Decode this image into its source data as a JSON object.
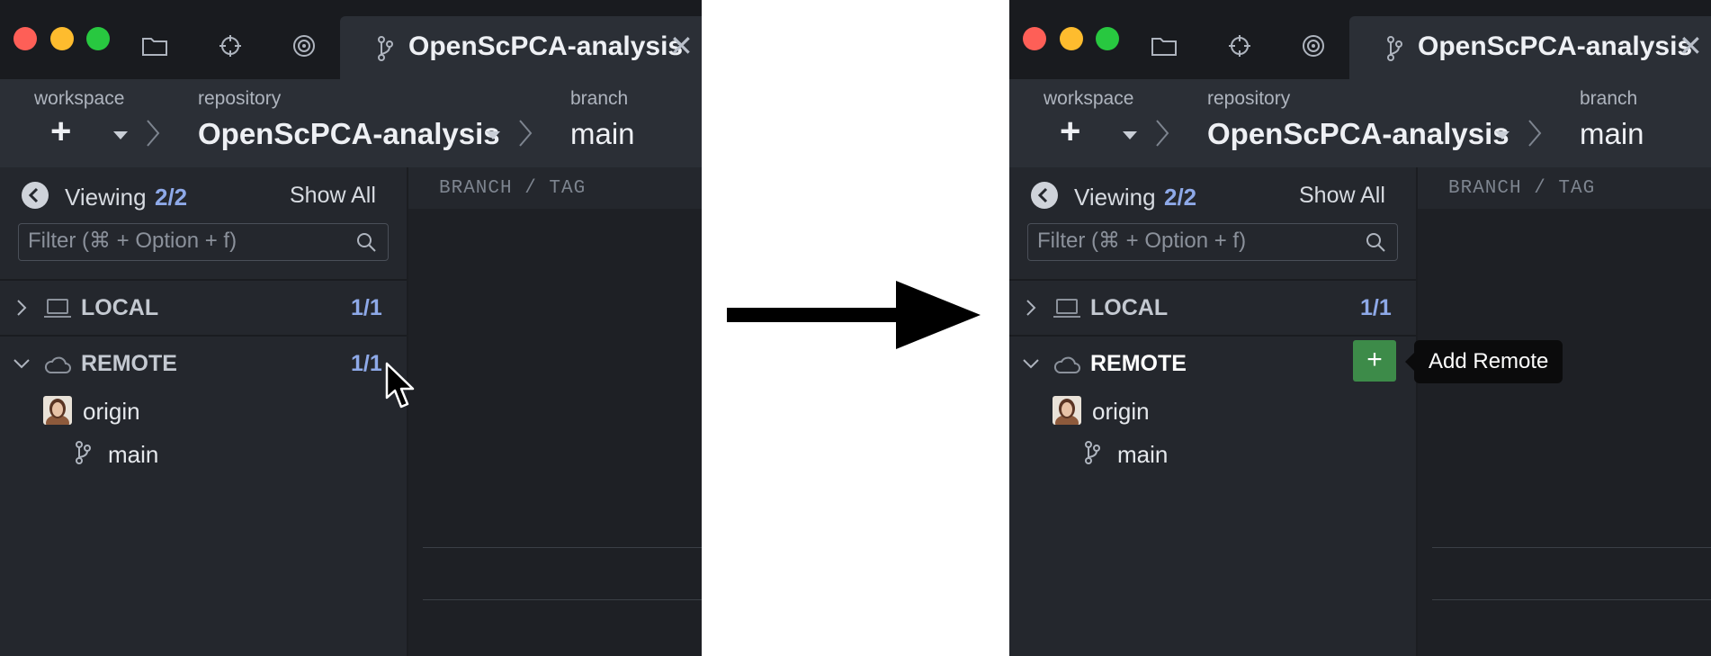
{
  "left": {
    "tab_title": "OpenScPCA-analysis",
    "tab_close": "✕",
    "toolbar": {
      "workspace_label": "workspace",
      "add_symbol": "+",
      "repository_label": "repository",
      "repository_name": "OpenScPCA-analysis",
      "branch_label": "branch",
      "branch_name": "main"
    },
    "sidebar": {
      "viewing_label": "Viewing",
      "viewing_count": "2/2",
      "show_all": "Show All",
      "filter_placeholder": "Filter (⌘ + Option + f)",
      "local_label": "LOCAL",
      "local_count": "1/1",
      "remote_label": "REMOTE",
      "remote_count": "1/1",
      "remote_name": "origin",
      "remote_branch": "main"
    },
    "content_header": "BRANCH / TAG"
  },
  "right": {
    "tab_title": "OpenScPCA-analysis",
    "tab_close": "✕",
    "toolbar": {
      "workspace_label": "workspace",
      "add_symbol": "+",
      "repository_label": "repository",
      "repository_name": "OpenScPCA-analysis",
      "branch_label": "branch",
      "branch_name": "main"
    },
    "sidebar": {
      "viewing_label": "Viewing",
      "viewing_count": "2/2",
      "show_all": "Show All",
      "filter_placeholder": "Filter (⌘ + Option + f)",
      "local_label": "LOCAL",
      "local_count": "1/1",
      "remote_label": "REMOTE",
      "add_remote_symbol": "+",
      "remote_name": "origin",
      "remote_branch": "main"
    },
    "content_header": "BRANCH / TAG",
    "tooltip": "Add Remote"
  },
  "colors": {
    "accent_count": "#8ea9e8",
    "add_button": "#3d8b49",
    "panel_bg": "#24272d",
    "titlebar_bg": "#191b1f"
  },
  "icons": [
    "folder-icon",
    "crosshair-icon",
    "radar-icon",
    "branch-icon",
    "laptop-icon",
    "cloud-icon",
    "search-icon",
    "back-arrow-icon",
    "cursor-icon"
  ]
}
